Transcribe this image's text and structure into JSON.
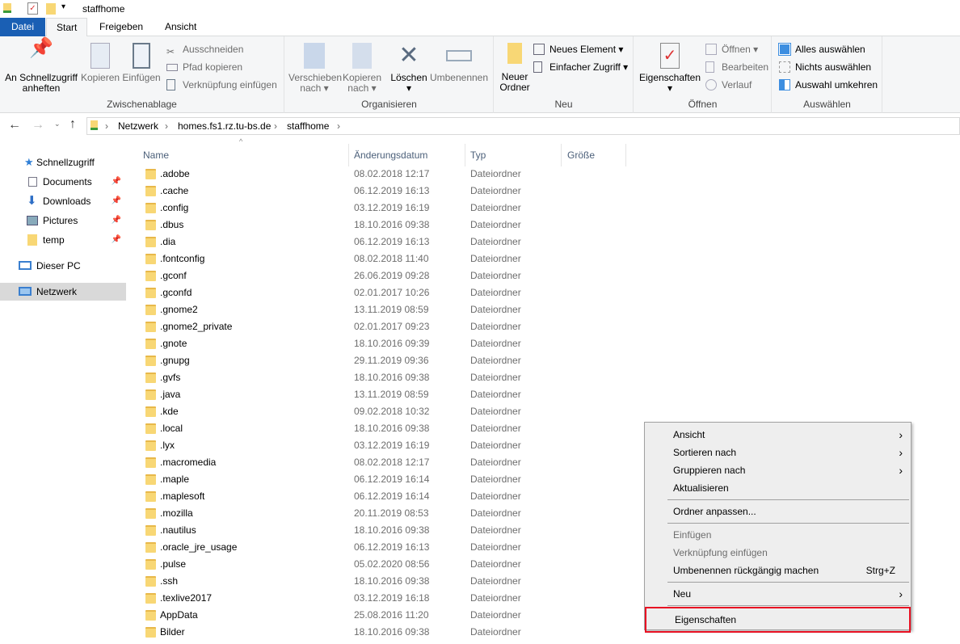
{
  "window": {
    "title": "staffhome"
  },
  "tabs": [
    {
      "label": "Datei"
    },
    {
      "label": "Start"
    },
    {
      "label": "Freigeben"
    },
    {
      "label": "Ansicht"
    }
  ],
  "ribbon": {
    "clipboard": {
      "label": "Zwischenablage",
      "pin": "An Schnellzugriff anheften",
      "copy": "Kopieren",
      "paste": "Einfügen",
      "cut": "Ausschneiden",
      "copy_path": "Pfad kopieren",
      "paste_shortcut": "Verknüpfung einfügen"
    },
    "organize": {
      "label": "Organisieren",
      "move": "Verschieben nach",
      "copy_to": "Kopieren nach",
      "delete": "Löschen",
      "rename": "Umbenennen"
    },
    "new": {
      "label": "Neu",
      "new_folder": "Neuer Ordner",
      "new_item": "Neues Element",
      "easy_access": "Einfacher Zugriff"
    },
    "open": {
      "label": "Öffnen",
      "properties": "Eigenschaften",
      "open": "Öffnen",
      "edit": "Bearbeiten",
      "history": "Verlauf"
    },
    "select": {
      "label": "Auswählen",
      "all": "Alles auswählen",
      "none": "Nichts auswählen",
      "invert": "Auswahl umkehren"
    }
  },
  "address": {
    "crumbs": [
      "Netzwerk",
      "homes.fs1.rz.tu-bs.de",
      "staffhome"
    ]
  },
  "nav": {
    "items": [
      {
        "label": "Schnellzugriff"
      },
      {
        "label": "Documents"
      },
      {
        "label": "Downloads"
      },
      {
        "label": "Pictures"
      },
      {
        "label": "temp"
      },
      {
        "label": "Dieser PC"
      },
      {
        "label": "Netzwerk"
      }
    ]
  },
  "columns": [
    "Name",
    "Änderungsdatum",
    "Typ",
    "Größe"
  ],
  "files": [
    [
      "​.adobe",
      "08.02.2018 12:17"
    ],
    [
      ".cache",
      "06.12.2019 16:13"
    ],
    [
      ".config",
      "03.12.2019 16:19"
    ],
    [
      ".dbus",
      "18.10.2016 09:38"
    ],
    [
      ".dia",
      "06.12.2019 16:13"
    ],
    [
      ".fontconfig",
      "08.02.2018 11:40"
    ],
    [
      ".gconf",
      "26.06.2019 09:28"
    ],
    [
      ".gconfd",
      "02.01.2017 10:26"
    ],
    [
      ".gnome2",
      "13.11.2019 08:59"
    ],
    [
      ".gnome2_private",
      "02.01.2017 09:23"
    ],
    [
      ".gnote",
      "18.10.2016 09:39"
    ],
    [
      ".gnupg",
      "29.11.2019 09:36"
    ],
    [
      ".gvfs",
      "18.10.2016 09:38"
    ],
    [
      ".java",
      "13.11.2019 08:59"
    ],
    [
      ".kde",
      "09.02.2018 10:32"
    ],
    [
      ".local",
      "18.10.2016 09:38"
    ],
    [
      ".lyx",
      "03.12.2019 16:19"
    ],
    [
      ".macromedia",
      "08.02.2018 12:17"
    ],
    [
      ".maple",
      "06.12.2019 16:14"
    ],
    [
      ".maplesoft",
      "06.12.2019 16:14"
    ],
    [
      ".mozilla",
      "20.11.2019 08:53"
    ],
    [
      ".nautilus",
      "18.10.2016 09:38"
    ],
    [
      ".oracle_jre_usage",
      "06.12.2019 16:13"
    ],
    [
      ".pulse",
      "05.02.2020 08:56"
    ],
    [
      ".ssh",
      "18.10.2016 09:38"
    ],
    [
      ".texlive2017",
      "03.12.2019 16:18"
    ],
    [
      "AppData",
      "25.08.2016 11:20"
    ],
    [
      "Bilder",
      "18.10.2016 09:38"
    ]
  ],
  "file_type": "Dateiordner",
  "context_menu": {
    "items": [
      {
        "label": "Ansicht",
        "submenu": true
      },
      {
        "label": "Sortieren nach",
        "submenu": true
      },
      {
        "label": "Gruppieren nach",
        "submenu": true
      },
      {
        "label": "Aktualisieren"
      },
      {
        "sep": true
      },
      {
        "label": "Ordner anpassen..."
      },
      {
        "sep": true
      },
      {
        "label": "Einfügen",
        "disabled": true
      },
      {
        "label": "Verknüpfung einfügen",
        "disabled": true
      },
      {
        "label": "Umbenennen rückgängig machen",
        "shortcut": "Strg+Z"
      },
      {
        "sep": true
      },
      {
        "label": "Neu",
        "submenu": true
      },
      {
        "sep": true
      },
      {
        "label": "Eigenschaften",
        "highlighted": true
      }
    ]
  },
  "colors": {
    "accent": "#1a5fb4",
    "highlight_border": "#e81123",
    "folder": "#f8d775"
  }
}
